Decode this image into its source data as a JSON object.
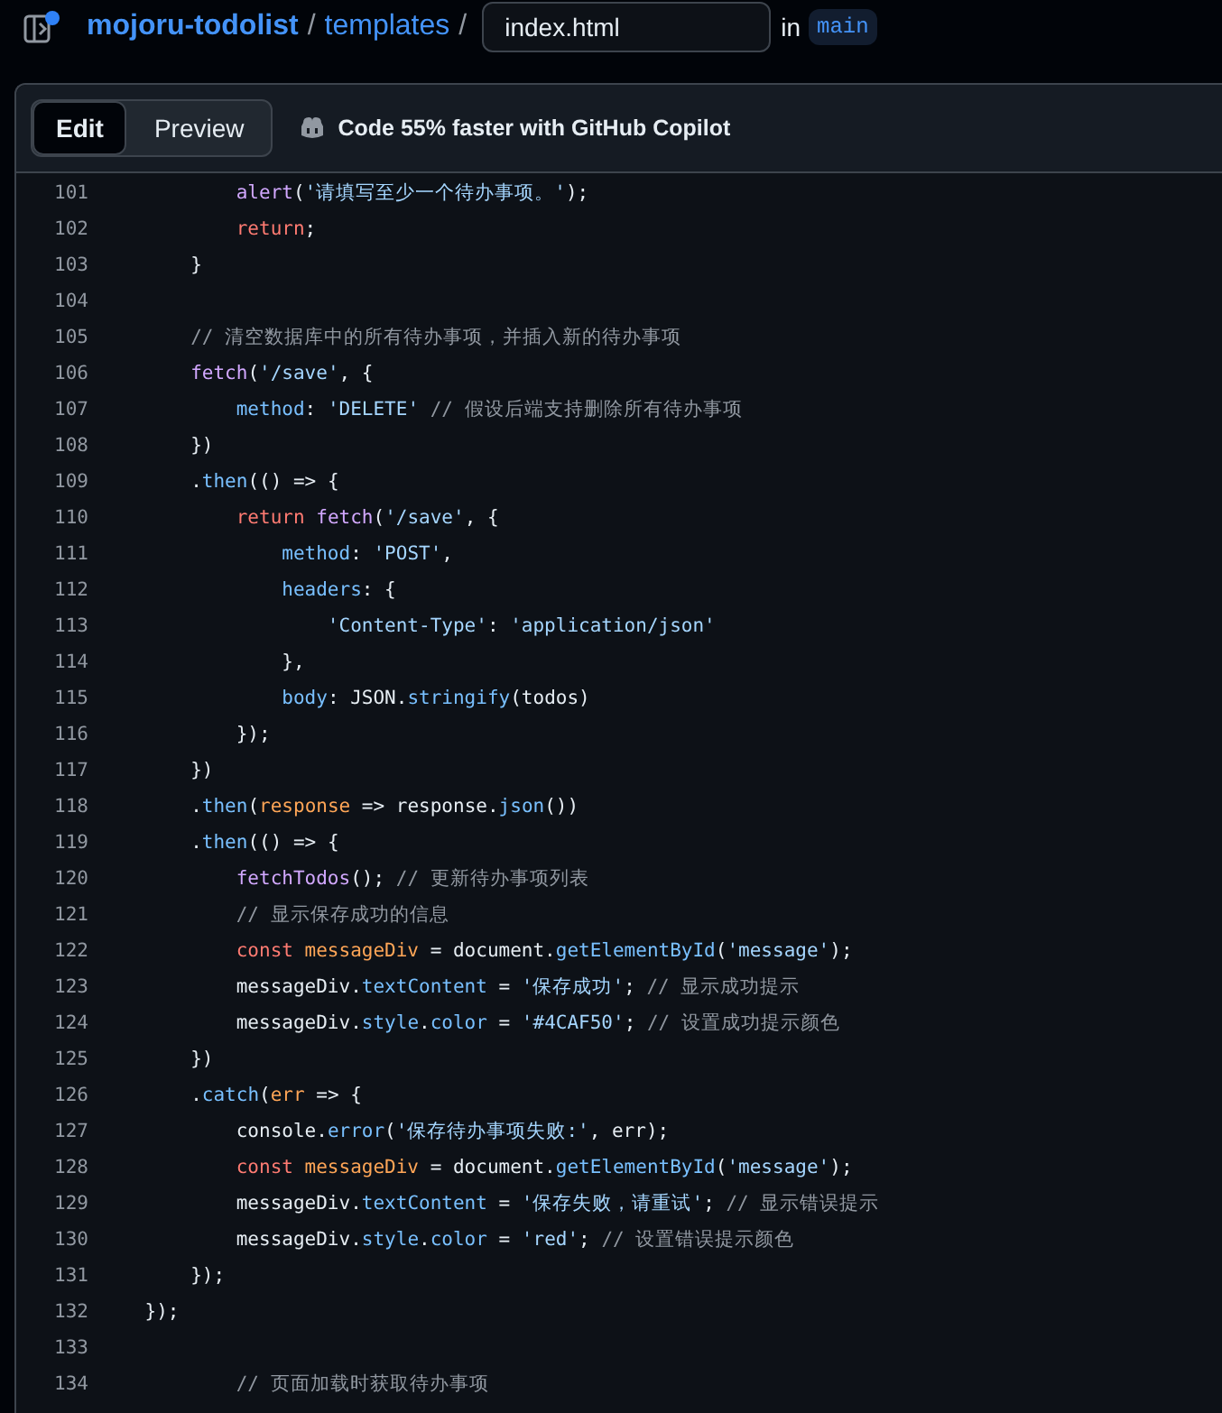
{
  "breadcrumb": {
    "repo": "mojoru-todolist",
    "separators": [
      "/",
      "/"
    ],
    "folder": "templates",
    "filename": "index.html",
    "in_label": "in",
    "branch": "main"
  },
  "editor_tabs": [
    {
      "label": "Edit",
      "selected": true
    },
    {
      "label": "Preview",
      "selected": false
    }
  ],
  "copilot_promo": "Code 55% faster with GitHub Copilot",
  "lines": [
    {
      "number": "101",
      "tokens": [
        {
          "kind": "function",
          "text": "            alert"
        },
        {
          "kind": "plain",
          "text": "("
        },
        {
          "kind": "string",
          "text": "'请填写至少一个待办事项。'"
        },
        {
          "kind": "plain",
          "text": ");"
        }
      ]
    },
    {
      "number": "102",
      "tokens": [
        {
          "kind": "keyword",
          "text": "            return"
        },
        {
          "kind": "plain",
          "text": ";"
        }
      ]
    },
    {
      "number": "103",
      "tokens": [
        {
          "kind": "plain",
          "text": "        }"
        }
      ]
    },
    {
      "number": "104"
    },
    {
      "number": "105",
      "tokens": [
        {
          "kind": "comment",
          "text": "        // 清空数据库中的所有待办事项，并插入新的待办事项"
        }
      ]
    },
    {
      "number": "106",
      "tokens": [
        {
          "kind": "function",
          "text": "        fetch"
        },
        {
          "kind": "plain",
          "text": "("
        },
        {
          "kind": "string",
          "text": "'/save'"
        },
        {
          "kind": "plain",
          "text": ", {"
        }
      ]
    },
    {
      "number": "107",
      "tokens": [
        {
          "kind": "property",
          "text": "            method"
        },
        {
          "kind": "plain",
          "text": ": "
        },
        {
          "kind": "string",
          "text": "'DELETE'"
        },
        {
          "kind": "comment",
          "text": " // 假设后端支持删除所有待办事项"
        }
      ]
    },
    {
      "number": "108",
      "tokens": [
        {
          "kind": "plain",
          "text": "        })"
        }
      ]
    },
    {
      "number": "109",
      "tokens": [
        {
          "kind": "plain",
          "text": "        ."
        },
        {
          "kind": "property",
          "text": "then"
        },
        {
          "kind": "plain",
          "text": "(() => {"
        }
      ]
    },
    {
      "number": "110",
      "tokens": [
        {
          "kind": "keyword",
          "text": "            return"
        },
        {
          "kind": "function",
          "text": " fetch"
        },
        {
          "kind": "plain",
          "text": "("
        },
        {
          "kind": "string",
          "text": "'/save'"
        },
        {
          "kind": "plain",
          "text": ", {"
        }
      ]
    },
    {
      "number": "111",
      "tokens": [
        {
          "kind": "property",
          "text": "                method"
        },
        {
          "kind": "plain",
          "text": ": "
        },
        {
          "kind": "string",
          "text": "'POST'"
        },
        {
          "kind": "plain",
          "text": ","
        }
      ]
    },
    {
      "number": "112",
      "tokens": [
        {
          "kind": "property",
          "text": "                headers"
        },
        {
          "kind": "plain",
          "text": ": {"
        }
      ]
    },
    {
      "number": "113",
      "tokens": [
        {
          "kind": "string",
          "text": "                    'Content-Type'"
        },
        {
          "kind": "plain",
          "text": ": "
        },
        {
          "kind": "string",
          "text": "'application/json'"
        }
      ]
    },
    {
      "number": "114",
      "tokens": [
        {
          "kind": "plain",
          "text": "                },"
        }
      ]
    },
    {
      "number": "115",
      "tokens": [
        {
          "kind": "property",
          "text": "                body"
        },
        {
          "kind": "plain",
          "text": ": JSON."
        },
        {
          "kind": "property",
          "text": "stringify"
        },
        {
          "kind": "plain",
          "text": "(todos)"
        }
      ]
    },
    {
      "number": "116",
      "tokens": [
        {
          "kind": "plain",
          "text": "            });"
        }
      ]
    },
    {
      "number": "117",
      "tokens": [
        {
          "kind": "plain",
          "text": "        })"
        }
      ]
    },
    {
      "number": "118",
      "tokens": [
        {
          "kind": "plain",
          "text": "        ."
        },
        {
          "kind": "property",
          "text": "then"
        },
        {
          "kind": "plain",
          "text": "("
        },
        {
          "kind": "variable",
          "text": "response"
        },
        {
          "kind": "plain",
          "text": " => response."
        },
        {
          "kind": "property",
          "text": "json"
        },
        {
          "kind": "plain",
          "text": "())"
        }
      ]
    },
    {
      "number": "119",
      "tokens": [
        {
          "kind": "plain",
          "text": "        ."
        },
        {
          "kind": "property",
          "text": "then"
        },
        {
          "kind": "plain",
          "text": "(() => {"
        }
      ]
    },
    {
      "number": "120",
      "tokens": [
        {
          "kind": "function",
          "text": "            fetchTodos"
        },
        {
          "kind": "plain",
          "text": "(); "
        },
        {
          "kind": "comment",
          "text": "// 更新待办事项列表"
        }
      ]
    },
    {
      "number": "121",
      "tokens": [
        {
          "kind": "comment",
          "text": "            // 显示保存成功的信息"
        }
      ]
    },
    {
      "number": "122",
      "tokens": [
        {
          "kind": "keyword",
          "text": "            const"
        },
        {
          "kind": "variable",
          "text": " messageDiv"
        },
        {
          "kind": "plain",
          "text": " = document."
        },
        {
          "kind": "property",
          "text": "getElementById"
        },
        {
          "kind": "plain",
          "text": "("
        },
        {
          "kind": "string",
          "text": "'message'"
        },
        {
          "kind": "plain",
          "text": ");"
        }
      ]
    },
    {
      "number": "123",
      "tokens": [
        {
          "kind": "plain",
          "text": "            messageDiv."
        },
        {
          "kind": "property",
          "text": "textContent"
        },
        {
          "kind": "plain",
          "text": " = "
        },
        {
          "kind": "string",
          "text": "'保存成功'"
        },
        {
          "kind": "plain",
          "text": "; "
        },
        {
          "kind": "comment",
          "text": "// 显示成功提示"
        }
      ]
    },
    {
      "number": "124",
      "tokens": [
        {
          "kind": "plain",
          "text": "            messageDiv."
        },
        {
          "kind": "property",
          "text": "style"
        },
        {
          "kind": "plain",
          "text": "."
        },
        {
          "kind": "property",
          "text": "color"
        },
        {
          "kind": "plain",
          "text": " = "
        },
        {
          "kind": "string",
          "text": "'#4CAF50'"
        },
        {
          "kind": "plain",
          "text": "; "
        },
        {
          "kind": "comment",
          "text": "// 设置成功提示颜色"
        }
      ]
    },
    {
      "number": "125",
      "tokens": [
        {
          "kind": "plain",
          "text": "        })"
        }
      ]
    },
    {
      "number": "126",
      "tokens": [
        {
          "kind": "plain",
          "text": "        ."
        },
        {
          "kind": "property",
          "text": "catch"
        },
        {
          "kind": "plain",
          "text": "("
        },
        {
          "kind": "variable",
          "text": "err"
        },
        {
          "kind": "plain",
          "text": " => {"
        }
      ]
    },
    {
      "number": "127",
      "tokens": [
        {
          "kind": "plain",
          "text": "            console."
        },
        {
          "kind": "property",
          "text": "error"
        },
        {
          "kind": "plain",
          "text": "("
        },
        {
          "kind": "string",
          "text": "'保存待办事项失败:'"
        },
        {
          "kind": "plain",
          "text": ", err);"
        }
      ]
    },
    {
      "number": "128",
      "tokens": [
        {
          "kind": "keyword",
          "text": "            const"
        },
        {
          "kind": "variable",
          "text": " messageDiv"
        },
        {
          "kind": "plain",
          "text": " = document."
        },
        {
          "kind": "property",
          "text": "getElementById"
        },
        {
          "kind": "plain",
          "text": "("
        },
        {
          "kind": "string",
          "text": "'message'"
        },
        {
          "kind": "plain",
          "text": ");"
        }
      ]
    },
    {
      "number": "129",
      "tokens": [
        {
          "kind": "plain",
          "text": "            messageDiv."
        },
        {
          "kind": "property",
          "text": "textContent"
        },
        {
          "kind": "plain",
          "text": " = "
        },
        {
          "kind": "string",
          "text": "'保存失败，请重试'"
        },
        {
          "kind": "plain",
          "text": "; "
        },
        {
          "kind": "comment",
          "text": "// 显示错误提示"
        }
      ]
    },
    {
      "number": "130",
      "tokens": [
        {
          "kind": "plain",
          "text": "            messageDiv."
        },
        {
          "kind": "property",
          "text": "style"
        },
        {
          "kind": "plain",
          "text": "."
        },
        {
          "kind": "property",
          "text": "color"
        },
        {
          "kind": "plain",
          "text": " = "
        },
        {
          "kind": "string",
          "text": "'red'"
        },
        {
          "kind": "plain",
          "text": "; "
        },
        {
          "kind": "comment",
          "text": "// 设置错误提示颜色"
        }
      ]
    },
    {
      "number": "131",
      "tokens": [
        {
          "kind": "plain",
          "text": "        });"
        }
      ]
    },
    {
      "number": "132",
      "tokens": [
        {
          "kind": "plain",
          "text": "    });"
        }
      ]
    },
    {
      "number": "133"
    },
    {
      "number": "134",
      "tokens": [
        {
          "kind": "comment",
          "text": "            // 页面加载时获取待办事项"
        }
      ]
    }
  ]
}
